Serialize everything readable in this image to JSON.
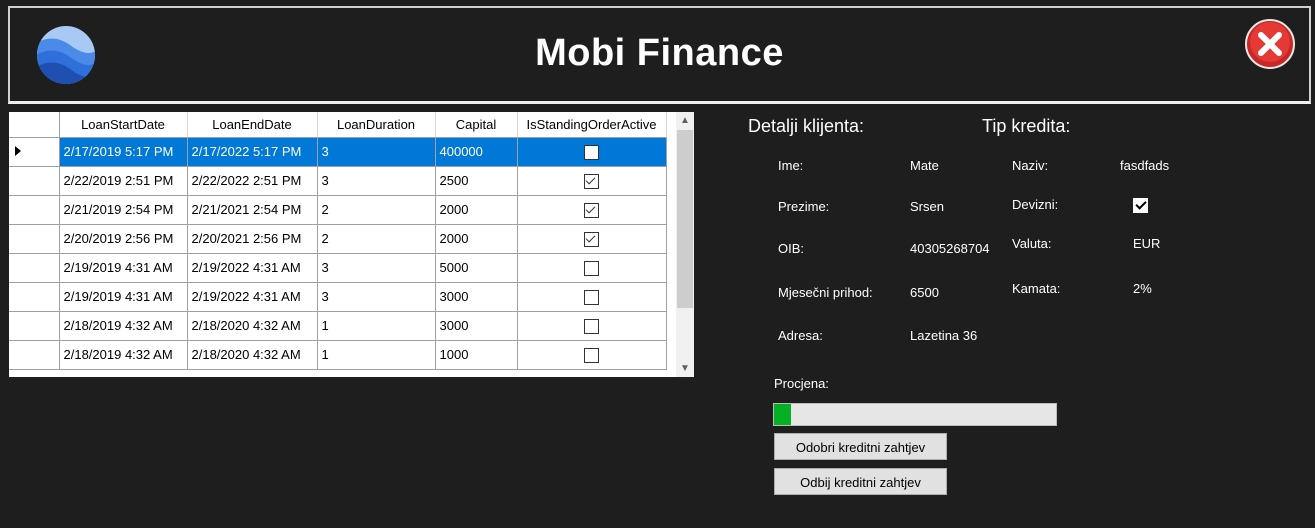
{
  "header": {
    "title": "Mobi Finance",
    "logo_icon": "blue-wave-circle-logo",
    "close_icon": "red-x-circle-close-icon",
    "colors": {
      "close": "#d32f2f",
      "logo": "#2b6fd6"
    }
  },
  "grid": {
    "columns": [
      "LoanStartDate",
      "LoanEndDate",
      "LoanDuration",
      "Capital",
      "IsStandingOrderActive"
    ],
    "selected_row": 0,
    "rows": [
      {
        "start": "2/17/2019 5:17 PM",
        "end": "2/17/2022 5:17 PM",
        "duration": "3",
        "capital": "400000",
        "standing": false
      },
      {
        "start": "2/22/2019 2:51 PM",
        "end": "2/22/2022 2:51 PM",
        "duration": "3",
        "capital": "2500",
        "standing": true
      },
      {
        "start": "2/21/2019 2:54 PM",
        "end": "2/21/2021 2:54 PM",
        "duration": "2",
        "capital": "2000",
        "standing": true
      },
      {
        "start": "2/20/2019 2:56 PM",
        "end": "2/20/2021 2:56 PM",
        "duration": "2",
        "capital": "2000",
        "standing": true
      },
      {
        "start": "2/19/2019 4:31 AM",
        "end": "2/19/2022 4:31 AM",
        "duration": "3",
        "capital": "5000",
        "standing": false
      },
      {
        "start": "2/19/2019 4:31 AM",
        "end": "2/19/2022 4:31 AM",
        "duration": "3",
        "capital": "3000",
        "standing": false
      },
      {
        "start": "2/18/2019 4:32 AM",
        "end": "2/18/2020 4:32 AM",
        "duration": "1",
        "capital": "3000",
        "standing": false
      },
      {
        "start": "2/18/2019 4:32 AM",
        "end": "2/18/2020 4:32 AM",
        "duration": "1",
        "capital": "1000",
        "standing": false
      }
    ]
  },
  "client": {
    "heading": "Detalji klijenta:",
    "ime_label": "Ime:",
    "ime_value": "Mate",
    "prezime_label": "Prezime:",
    "prezime_value": "Srsen",
    "oib_label": "OIB:",
    "oib_value": "40305268704",
    "prihod_label": "Mjesečni prihod:",
    "prihod_value": "6500",
    "adresa_label": "Adresa:",
    "adresa_value": "Lazetina 36"
  },
  "credit": {
    "heading": "Tip kredita:",
    "naziv_label": "Naziv:",
    "naziv_value": "fasdfads",
    "devizni_label": "Devizni:",
    "devizni_checked": true,
    "valuta_label": "Valuta:",
    "valuta_value": "EUR",
    "kamata_label": "Kamata:",
    "kamata_value": "2%"
  },
  "assessment": {
    "label": "Procjena:",
    "progress_fraction": 0.06,
    "approve_label": "Odobri kreditni zahtjev",
    "reject_label": "Odbij kreditni zahtjev"
  }
}
